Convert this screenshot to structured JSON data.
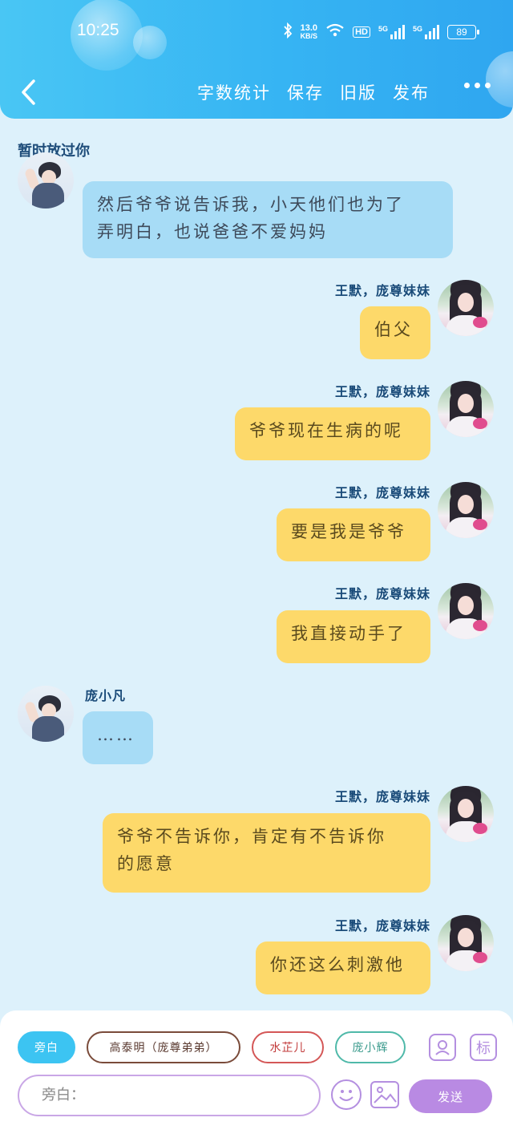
{
  "status_bar": {
    "time": "10:25",
    "net_speed_value": "13.0",
    "net_speed_unit": "KB/S",
    "hd_label": "HD",
    "sim1_label": "5G",
    "sim2_label": "5G",
    "battery": "89"
  },
  "nav": {
    "actions": [
      "字数统计",
      "保存",
      "旧版",
      "发布"
    ]
  },
  "chat": {
    "title": "暂时放过你",
    "messages": [
      {
        "side": "left",
        "name": "",
        "text_lines": [
          "然后爷爷说告诉我，小天他们也为了",
          "弄明白，也说爸爸不爱妈妈"
        ]
      },
      {
        "side": "right",
        "name": "王默，庞尊妹妹",
        "text_lines": [
          "伯父"
        ]
      },
      {
        "side": "right",
        "name": "王默，庞尊妹妹",
        "text_lines": [
          "爷爷现在生病的呢"
        ]
      },
      {
        "side": "right",
        "name": "王默，庞尊妹妹",
        "text_lines": [
          "要是我是爷爷"
        ]
      },
      {
        "side": "right",
        "name": "王默，庞尊妹妹",
        "text_lines": [
          "我直接动手了"
        ]
      },
      {
        "side": "left",
        "name": "庞小凡",
        "text_lines": [
          "……"
        ]
      },
      {
        "side": "right",
        "name": "王默，庞尊妹妹",
        "text_lines": [
          "爷爷不告诉你，肯定有不告诉你",
          "的愿意"
        ]
      },
      {
        "side": "right",
        "name": "王默，庞尊妹妹",
        "text_lines": [
          "你还这么刺激他"
        ]
      }
    ]
  },
  "panel": {
    "chips": [
      "旁白",
      "高泰明（庞尊弟弟）",
      "水芷儿",
      "庞小辉"
    ],
    "icon_btn_2_label": "标",
    "input_placeholder": "旁白：",
    "send_label": "发送"
  },
  "colors": {
    "header": "#36b4f3",
    "bubble_right": "#fdd96a",
    "bubble_left": "#a7dcf6",
    "send": "#b98ae3",
    "background": "#ddf1fb"
  }
}
